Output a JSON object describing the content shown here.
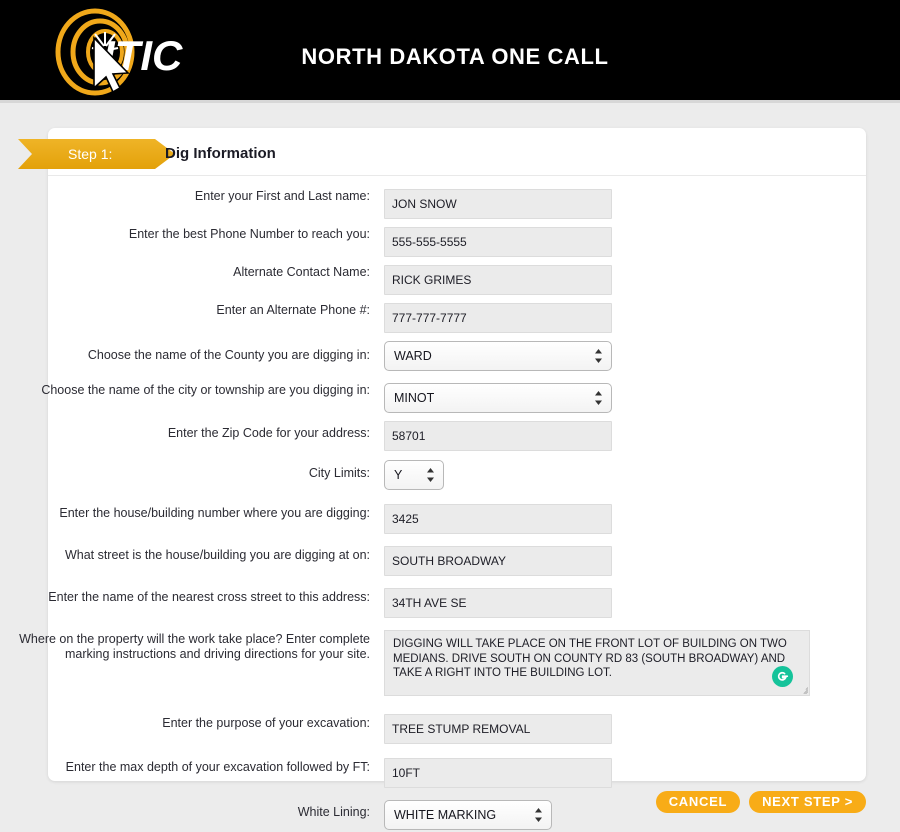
{
  "header": {
    "title": "NORTH DAKOTA ONE CALL",
    "logo_text": "ITIC",
    "logo_icon": "itic-target-cursor-logo"
  },
  "step": {
    "badge": "Step 1:",
    "title": "Dig Information"
  },
  "form": {
    "rows": [
      {
        "label": "Enter your First and Last name:",
        "type": "text",
        "value": "JON SNOW",
        "name": "first-last-name"
      },
      {
        "label": "Enter the best Phone Number to reach you:",
        "type": "text",
        "value": "555-555-5555",
        "name": "phone-number"
      },
      {
        "label": "Alternate Contact Name:",
        "type": "text",
        "value": "RICK GRIMES",
        "name": "alternate-contact-name"
      },
      {
        "label": "Enter an Alternate Phone #:",
        "type": "text",
        "value": "777-777-7777",
        "name": "alternate-phone"
      },
      {
        "label": "Choose the name of the County you are digging in:",
        "type": "select",
        "value": "WARD",
        "name": "county"
      },
      {
        "label": "Choose the name of the city or township are you digging in:",
        "type": "select",
        "value": "MINOT",
        "name": "city-township"
      },
      {
        "label": "Enter the Zip Code for your address:",
        "type": "text",
        "value": "58701",
        "name": "zip-code"
      },
      {
        "label": "City Limits:",
        "type": "select-small",
        "value": "Y",
        "name": "city-limits"
      },
      {
        "label": "Enter the house/building number where you are digging:",
        "type": "text",
        "value": "3425",
        "name": "house-number"
      },
      {
        "label": "What street is the house/building you are digging at on:",
        "type": "text",
        "value": "SOUTH BROADWAY",
        "name": "street"
      },
      {
        "label": "Enter the name of the nearest cross street to this address:",
        "type": "text",
        "value": "34TH AVE SE",
        "name": "cross-street"
      },
      {
        "label": "Where on the property will the work take place? Enter complete marking instructions and driving directions for your site.",
        "type": "textarea",
        "value": "DIGGING WILL TAKE PLACE ON THE FRONT LOT OF BUILDING ON TWO MEDIANS. DRIVE SOUTH ON COUNTY RD 83 (SOUTH BROADWAY) AND TAKE A RIGHT INTO THE BUILDING LOT.",
        "name": "work-location-instructions"
      },
      {
        "label": "Enter the purpose of your excavation:",
        "type": "text",
        "value": "TREE STUMP REMOVAL",
        "name": "excavation-purpose"
      },
      {
        "label": "Enter the max depth of your excavation followed by FT:",
        "type": "text",
        "value": "10FT",
        "name": "max-depth"
      },
      {
        "label": "White Lining:",
        "type": "select-mid",
        "value": "WHITE MARKING",
        "name": "white-lining"
      }
    ]
  },
  "footer": {
    "cancel_label": "CANCEL",
    "next_label": "NEXT STEP >"
  },
  "icons": {
    "grammarly": "grammarly-icon",
    "select_arrows": "up-down-arrows-icon",
    "resize": "resize-handle-icon"
  },
  "colors": {
    "accent_orange": "#f8ac17",
    "banner_gold": "#e9a70f",
    "header_black": "#000000",
    "page_gray": "#ececec",
    "input_gray": "#ebebeb",
    "grammarly_green": "#15c39a"
  }
}
